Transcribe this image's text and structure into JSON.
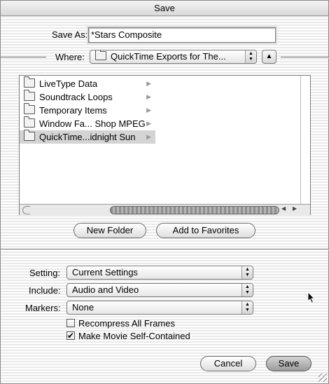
{
  "window": {
    "title": "Save"
  },
  "save_as": {
    "label": "Save As:",
    "value": "*Stars Composite"
  },
  "where": {
    "label": "Where:",
    "value": "QuickTime Exports for The..."
  },
  "browser": {
    "column1": [
      {
        "label": "LiveType Data",
        "selected": false
      },
      {
        "label": "Soundtrack Loops",
        "selected": false
      },
      {
        "label": "Temporary Items",
        "selected": false
      },
      {
        "label": "Window Fa... Shop MPEG",
        "selected": false
      },
      {
        "label": "QuickTime...idnight Sun",
        "selected": true
      }
    ]
  },
  "buttons": {
    "new_folder": "New Folder",
    "add_favorites": "Add to Favorites",
    "cancel": "Cancel",
    "save": "Save"
  },
  "options": {
    "setting": {
      "label": "Setting:",
      "value": "Current Settings"
    },
    "include": {
      "label": "Include:",
      "value": "Audio and Video"
    },
    "markers": {
      "label": "Markers:",
      "value": "None"
    },
    "recompress": {
      "label": "Recompress All Frames",
      "checked": false
    },
    "self_contained": {
      "label": "Make Movie Self-Contained",
      "checked": true
    }
  },
  "icons": {
    "folder": "folder-icon",
    "up": "up-arrow-icon",
    "popup": "popup-arrows-icon",
    "check": "checkmark-icon"
  }
}
